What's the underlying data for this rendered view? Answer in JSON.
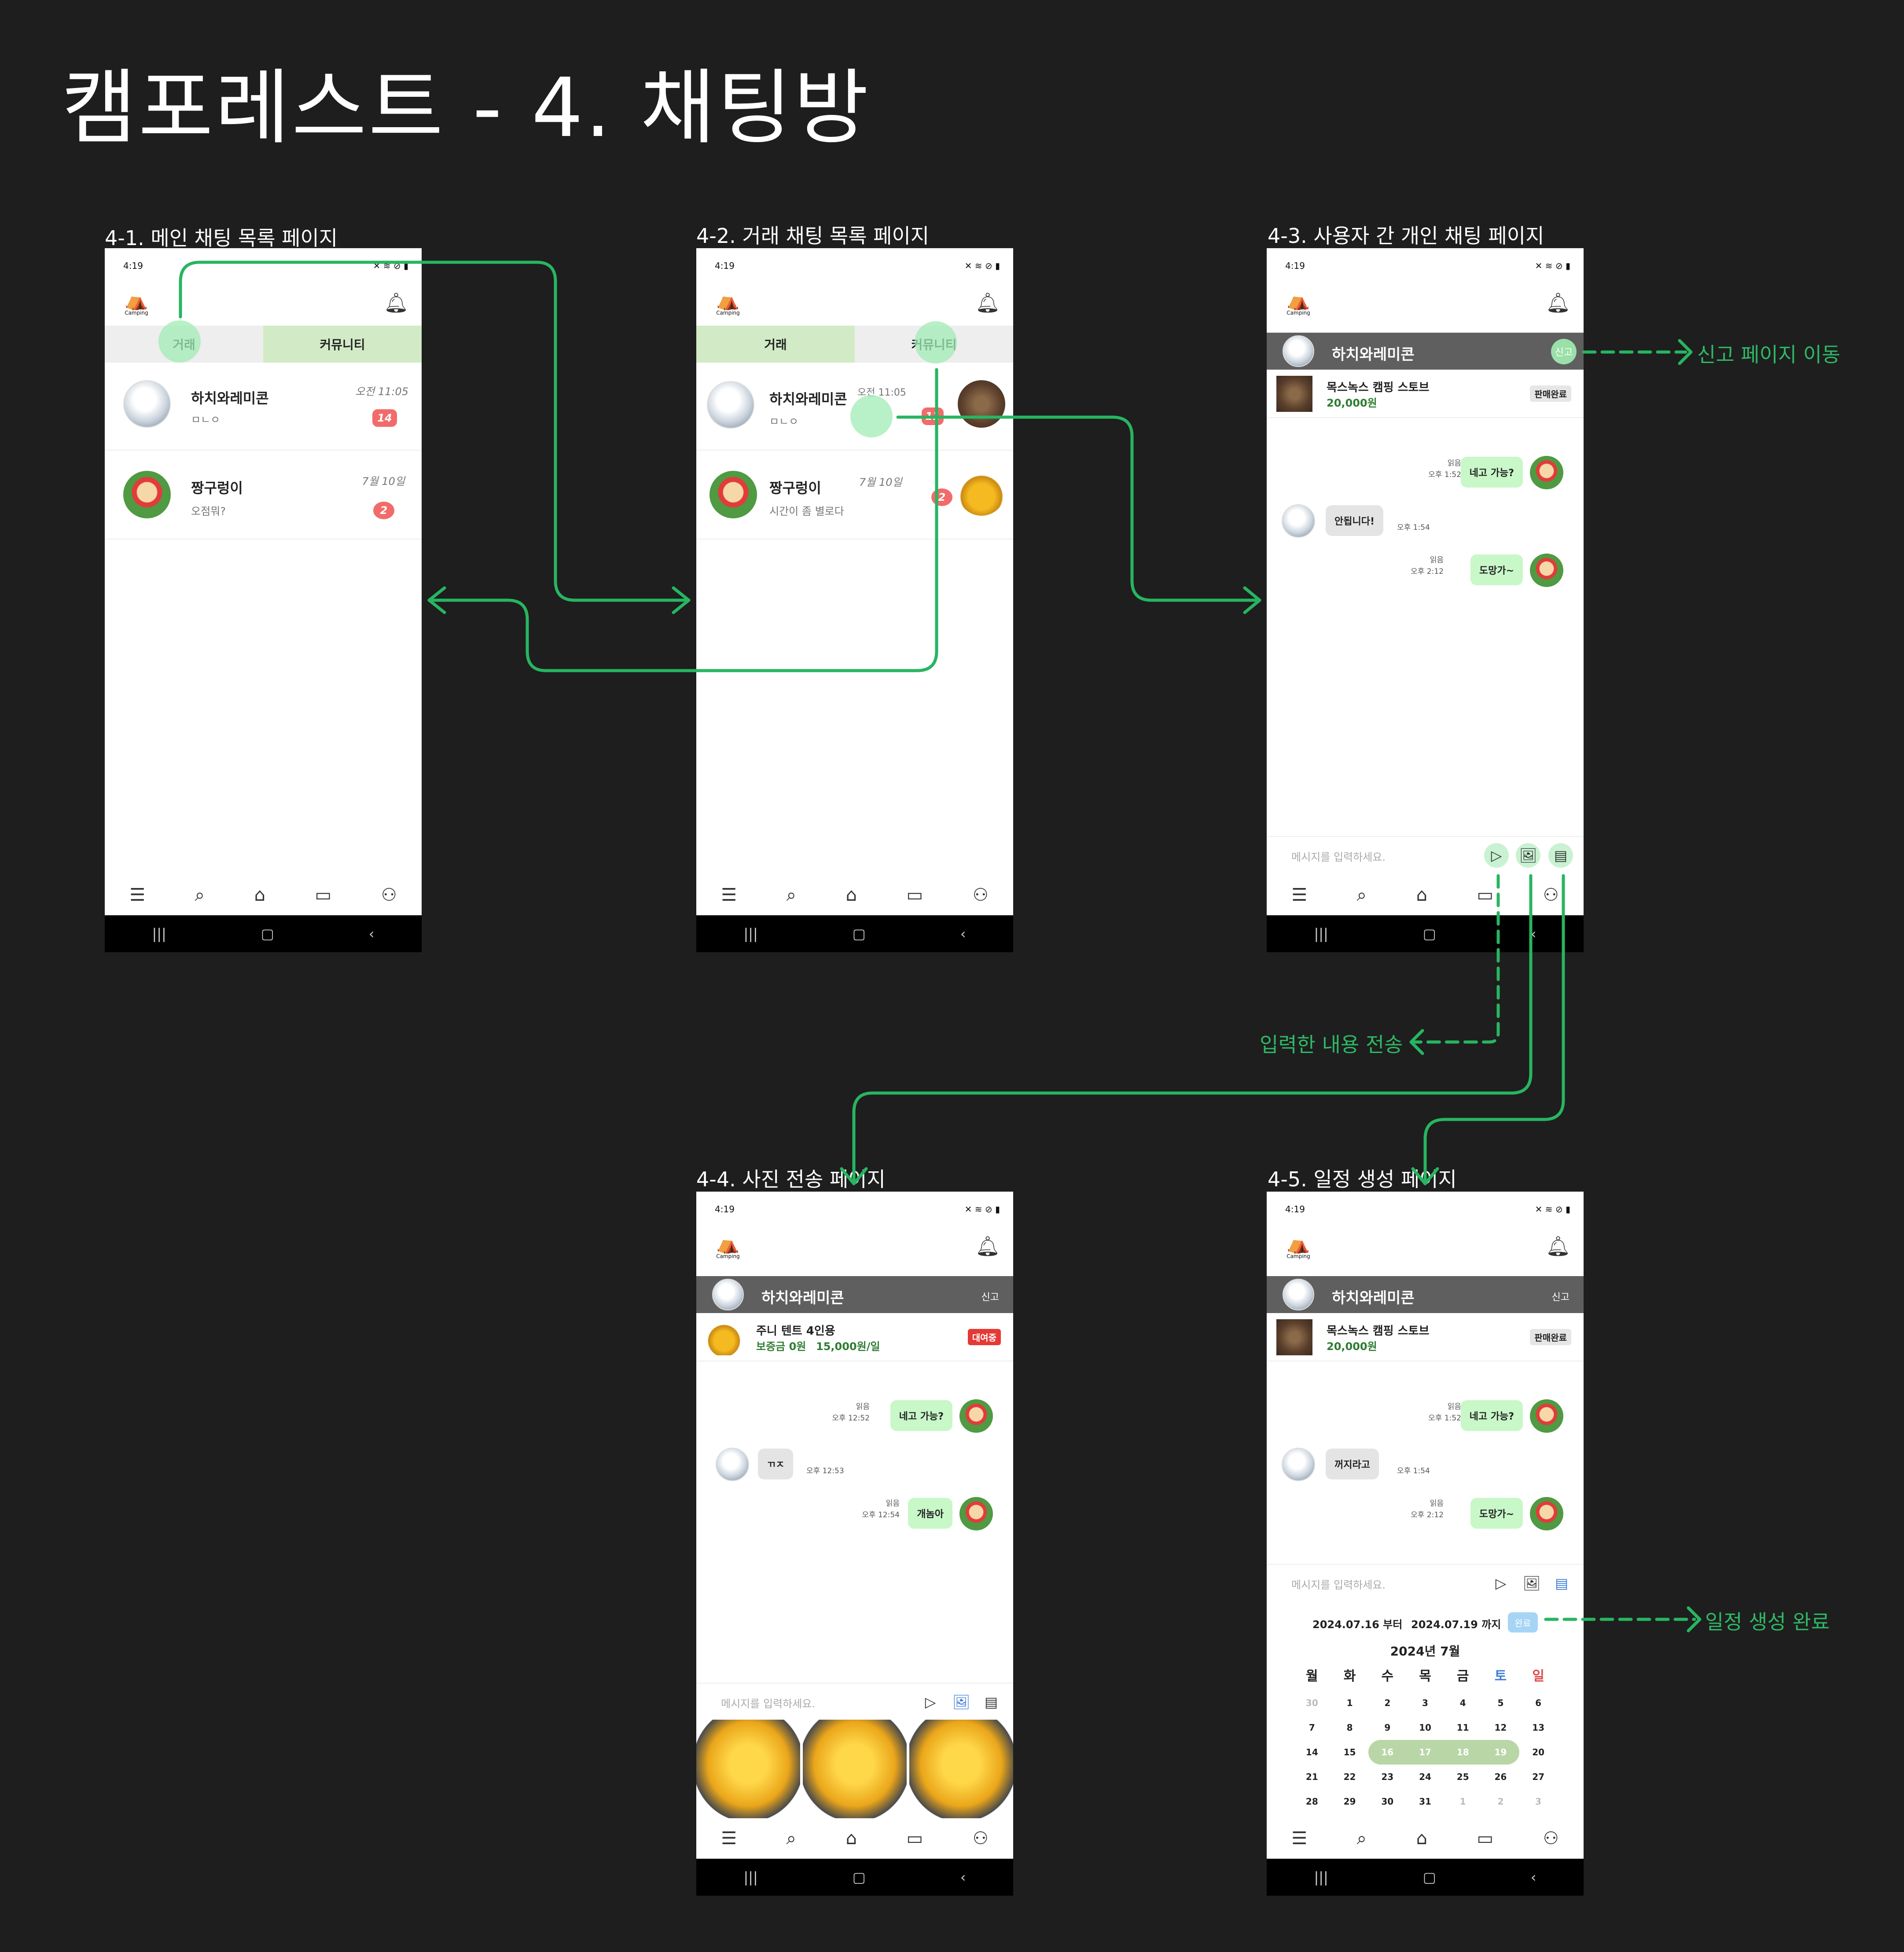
{
  "title": "캠포레스트 - 4. 채팅방",
  "colors": {
    "background": "#1e1e1e",
    "accent": "#2fb765",
    "badge": "#f26b6b",
    "tab_active": "#d2ebc6",
    "bubble_me": "#c8f7c8"
  },
  "frames": [
    {
      "label": "4-1. 메인 채팅 목록 페이지",
      "status_time": "4:19",
      "logo_text": "Camping",
      "tabs": [
        "거래",
        "커뮤니티"
      ],
      "chats": [
        {
          "name": "하치와레미콘",
          "preview": "ㅁㄴㅇ",
          "time": "오전 11:05",
          "unread": "14"
        },
        {
          "name": "짱구렁이",
          "preview": "오점뭐?",
          "time": "7월 10일",
          "unread": "2"
        }
      ]
    },
    {
      "label": "4-2. 거래 채팅 목록 페이지",
      "status_time": "4:19",
      "logo_text": "Camping",
      "tabs": [
        "거래",
        "커뮤니티"
      ],
      "chats": [
        {
          "name": "하치와레미콘",
          "preview": "ㅁㄴㅇ",
          "time": "오전 11:05",
          "unread": "11"
        },
        {
          "name": "짱구렁이",
          "preview": "시간이 좀 별로다",
          "time": "7월 10일",
          "unread": "2"
        }
      ]
    },
    {
      "label": "4-3. 사용자 간 개인 채팅 페이지",
      "status_time": "4:19",
      "logo_text": "Camping",
      "partner": "하치와레미콘",
      "report": "신고",
      "product": {
        "name": "목스녹스 캠핑 스토브",
        "price": "20,000원",
        "status": "판매완료"
      },
      "messages": [
        {
          "read": "읽음",
          "time": "오후 1:52",
          "text": "네고 가능?"
        },
        {
          "time": "오후 1:54",
          "text": "안됩니다!"
        },
        {
          "read": "읽음",
          "time": "오후 2:12",
          "text": "도망가~"
        }
      ],
      "input_placeholder": "메시지를 입력하세요."
    },
    {
      "label": "4-4. 사진 전송 페이지",
      "status_time": "4:19",
      "logo_text": "Camping",
      "partner": "하치와레미콘",
      "report": "신고",
      "product": {
        "name": "주니 텐트 4인용",
        "deposit": "보증금 0원",
        "price": "15,000원/일",
        "status": "대여중"
      },
      "messages": [
        {
          "read": "읽음",
          "time": "오후 12:52",
          "text": "네고 가능?"
        },
        {
          "time": "오후 12:53",
          "text": "ㄲㅈ"
        },
        {
          "read": "읽음",
          "time": "오후 12:54",
          "text": "개놈아"
        }
      ],
      "input_placeholder": "메시지를 입력하세요."
    },
    {
      "label": "4-5. 일정 생성 페이지",
      "status_time": "4:19",
      "logo_text": "Camping",
      "partner": "하치와레미콘",
      "report": "신고",
      "product": {
        "name": "목스녹스 캠핑 스토브",
        "price": "20,000원",
        "status": "판매완료"
      },
      "messages": [
        {
          "read": "읽음",
          "time": "오후 1:52",
          "text": "네고 가능?"
        },
        {
          "time": "오후 1:54",
          "text": "꺼지라고"
        },
        {
          "read": "읽음",
          "time": "오후 2:12",
          "text": "도망가~"
        }
      ],
      "input_placeholder": "메시지를 입력하세요.",
      "range_start": "2024.07.16 부터",
      "range_end": "2024.07.19 까지",
      "done_label": "완료",
      "calendar": {
        "header": "2024년    7월",
        "weekdays": [
          "월",
          "화",
          "수",
          "목",
          "금",
          "토",
          "일"
        ],
        "weeks": [
          [
            "30",
            "1",
            "2",
            "3",
            "4",
            "5",
            "6"
          ],
          [
            "7",
            "8",
            "9",
            "10",
            "11",
            "12",
            "13"
          ],
          [
            "14",
            "15",
            "16",
            "17",
            "18",
            "19",
            "20"
          ],
          [
            "21",
            "22",
            "23",
            "24",
            "25",
            "26",
            "27"
          ],
          [
            "28",
            "29",
            "30",
            "31",
            "1",
            "2",
            "3"
          ]
        ],
        "selected": [
          "16",
          "17",
          "18",
          "19"
        ]
      }
    }
  ],
  "annotations": {
    "report": "신고 페이지 이동",
    "send": "입력한 내용 전송",
    "schedule_done": "일정 생성 완료"
  },
  "icons": {
    "nav": [
      "menu-icon",
      "search-icon",
      "home-icon",
      "chat-icon",
      "profile-icon"
    ],
    "input": [
      "send-icon",
      "image-icon",
      "calendar-icon"
    ]
  }
}
